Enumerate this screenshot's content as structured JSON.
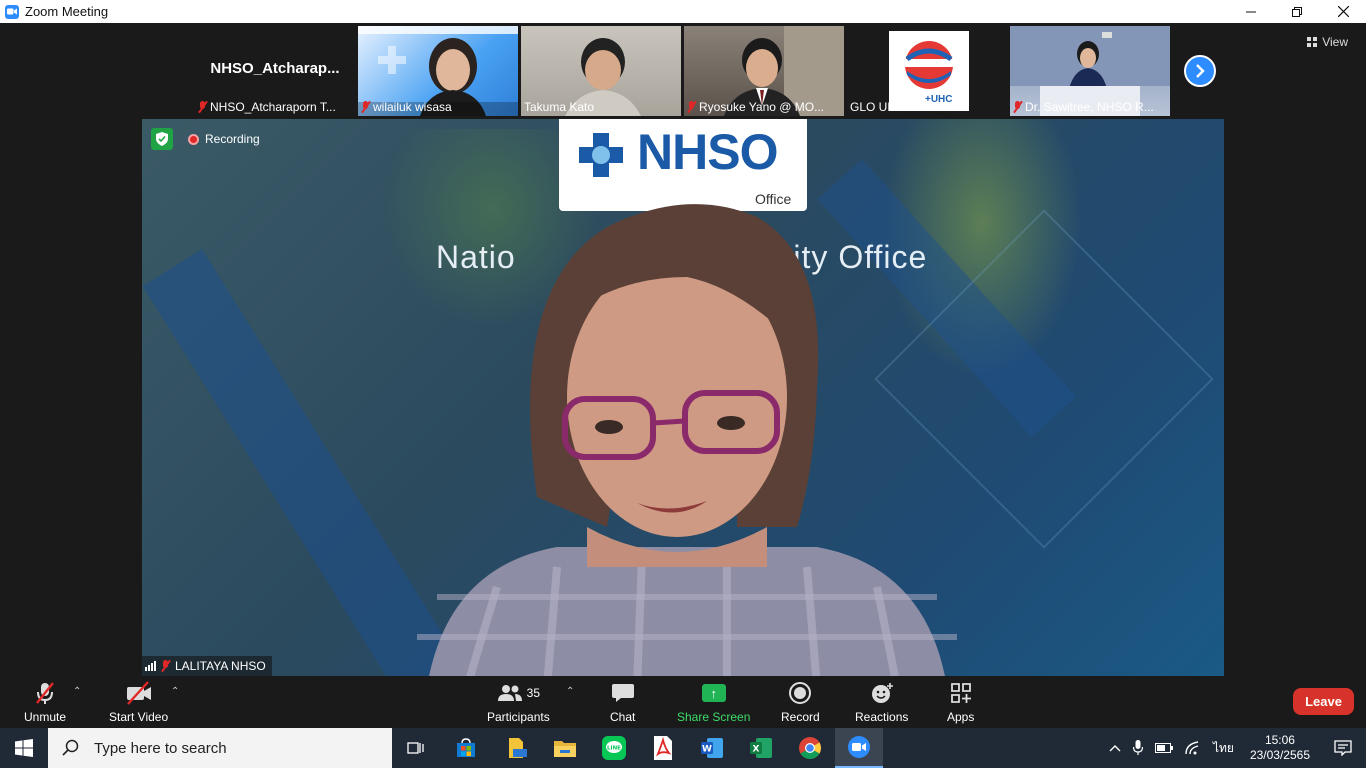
{
  "window": {
    "title": "Zoom Meeting"
  },
  "view_label": "View",
  "thumbnails": [
    {
      "display_name": "NHSO_Atcharap...",
      "name": "NHSO_Atcharaporn T...",
      "muted": true
    },
    {
      "name": "wilailuk wisasa",
      "muted": true
    },
    {
      "name": "Takuma Kato",
      "muted": false
    },
    {
      "name": "Ryosuke Yano @ MO...",
      "muted": true
    },
    {
      "name": "GLO UHC2",
      "muted": false,
      "logo_text": "+UHC"
    },
    {
      "name": "Dr. Sawitree, NHSO R...",
      "muted": true
    }
  ],
  "main_video": {
    "recording_label": "Recording",
    "speaker_name": "LALITAYA NHSO",
    "logo_text": "NHSO",
    "logo_sub": "Office",
    "banner_text": "Natio                         urity Office"
  },
  "toolbar": {
    "unmute": "Unmute",
    "start_video": "Start Video",
    "participants": "Participants",
    "participant_count": "35",
    "chat": "Chat",
    "share_screen": "Share Screen",
    "record": "Record",
    "reactions": "Reactions",
    "apps": "Apps",
    "leave": "Leave"
  },
  "taskbar": {
    "search_placeholder": "Type here to search",
    "language": "ไทย",
    "time": "15:06",
    "date": "23/03/2565"
  },
  "colors": {
    "zoom_blue": "#2d8cff",
    "leave_red": "#d8332a",
    "share_green": "#20b454",
    "recording_red": "#e02828"
  }
}
